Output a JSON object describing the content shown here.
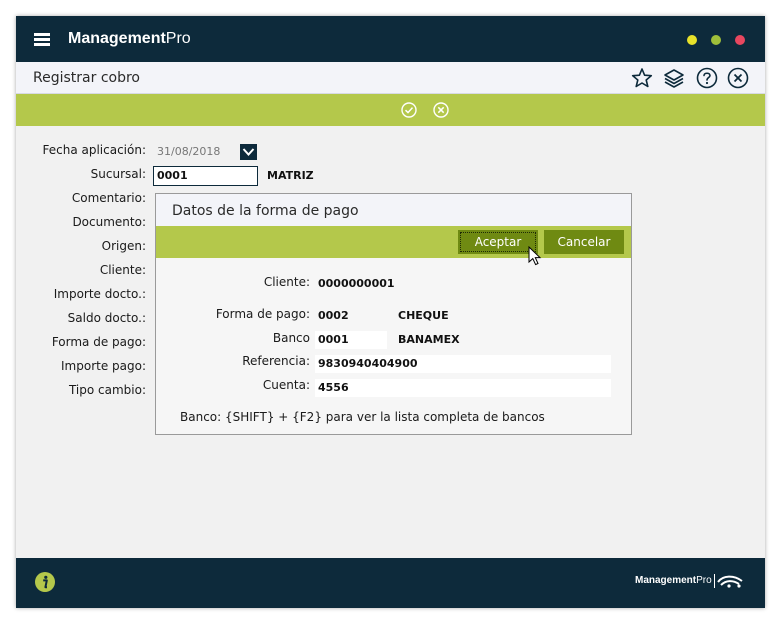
{
  "app": {
    "brand_bold": "Management",
    "brand_light": "Pro",
    "window_buttons": {
      "minimize_color": "#e8e22a",
      "maximize_color": "#9fbf3a",
      "close_color": "#e8475f"
    }
  },
  "toolbar": {
    "title": "Registrar cobro",
    "icons": [
      "star-icon",
      "layers-icon",
      "help-icon",
      "close-icon"
    ]
  },
  "actionbar": {
    "icons": [
      "check-icon",
      "cancel-icon"
    ]
  },
  "form": {
    "fecha_label": "Fecha aplicación:",
    "fecha_value": "31/08/2018",
    "sucursal_label": "Sucursal:",
    "sucursal_value": "0001",
    "sucursal_name": "MATRIZ",
    "comentario_label": "Comentario:",
    "documento_label": "Documento:",
    "origen_label": "Origen:",
    "cliente_label": "Cliente:",
    "importe_docto_label": "Importe docto.:",
    "saldo_docto_label": "Saldo docto.:",
    "forma_pago_label": "Forma de pago:",
    "importe_pago_label": "Importe pago:",
    "tipo_cambio_label": "Tipo cambio:"
  },
  "dialog": {
    "title": "Datos de la forma de pago",
    "accept_label": "Aceptar",
    "cancel_label": "Cancelar",
    "cliente_label": "Cliente:",
    "cliente_value": "0000000001",
    "forma_pago_label": "Forma de pago:",
    "forma_pago_code": "0002",
    "forma_pago_name": "CHEQUE",
    "banco_label": "Banco",
    "banco_code": "0001",
    "banco_name": "BANAMEX",
    "referencia_label": "Referencia:",
    "referencia_value": "9830940404900",
    "cuenta_label": "Cuenta:",
    "cuenta_value": "4556",
    "hint": "Banco: {SHIFT} + {F2} para ver la lista completa de bancos"
  },
  "footer": {
    "brand_bold": "Management",
    "brand_light": "Pro",
    "icons": [
      "info-icon"
    ],
    "accent_color": "#b4c84b"
  }
}
